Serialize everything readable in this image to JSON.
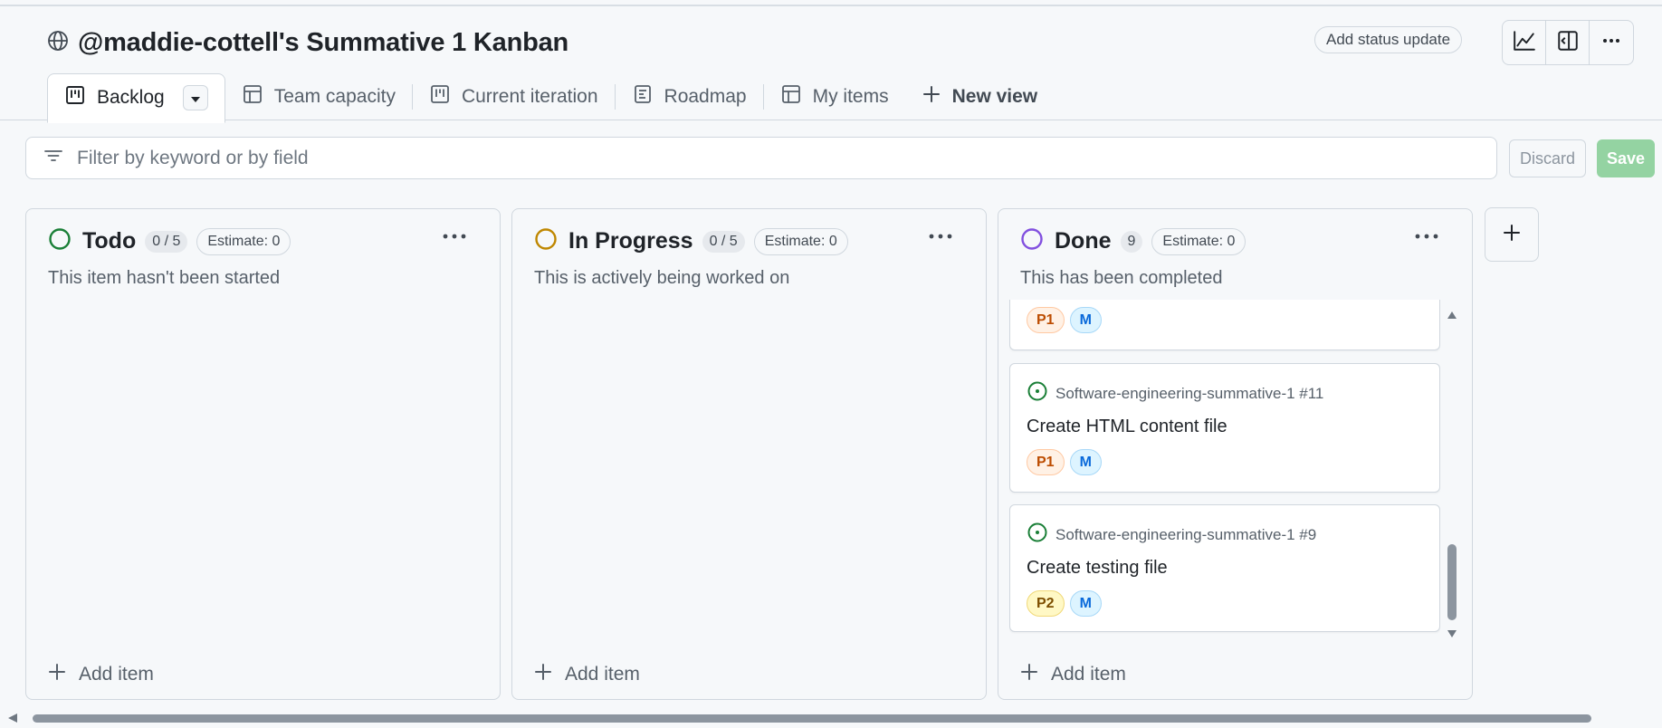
{
  "header": {
    "title": "@maddie-cottell's Summative 1 Kanban",
    "status_update_label": "Add status update"
  },
  "tabs": [
    {
      "label": "Backlog",
      "icon": "board-icon",
      "active": true
    },
    {
      "label": "Team capacity",
      "icon": "table-icon"
    },
    {
      "label": "Current iteration",
      "icon": "board-icon"
    },
    {
      "label": "Roadmap",
      "icon": "roadmap-icon"
    },
    {
      "label": "My items",
      "icon": "table-icon"
    },
    {
      "label": "New view",
      "icon": "plus-icon"
    }
  ],
  "filter": {
    "placeholder": "Filter by keyword or by field",
    "discard_label": "Discard",
    "save_label": "Save"
  },
  "columns": [
    {
      "name": "Todo",
      "count": "0 / 5",
      "estimate": "Estimate: 0",
      "description": "This item hasn't been started",
      "status_color": "#1a7f37",
      "add_label": "Add item"
    },
    {
      "name": "In Progress",
      "count": "0 / 5",
      "estimate": "Estimate: 0",
      "description": "This is actively being worked on",
      "status_color": "#bf8700",
      "add_label": "Add item"
    },
    {
      "name": "Done",
      "count": "9",
      "estimate": "Estimate: 0",
      "description": "This has been completed",
      "status_color": "#8250df",
      "add_label": "Add item",
      "cards": [
        {
          "labels": [
            "P1",
            "M"
          ]
        },
        {
          "ref": "Software-engineering-summative-1 #11",
          "title": "Create HTML content file",
          "labels": [
            "P1",
            "M"
          ]
        },
        {
          "ref": "Software-engineering-summative-1 #9",
          "title": "Create testing file",
          "labels": [
            "P2",
            "M"
          ]
        }
      ]
    }
  ],
  "colors": {
    "p1_bg": "#fff1e5",
    "p1_border": "#ffc9a3",
    "p1_text": "#bc4c00",
    "p2_bg": "#fff8c5",
    "p2_border": "#f0d878",
    "p2_text": "#7d4e00",
    "m_bg": "#ddf4ff",
    "m_border": "#a8d8f8",
    "m_text": "#0969da",
    "issue_open": "#1a7f37",
    "save_disabled": "#94d3a2"
  }
}
